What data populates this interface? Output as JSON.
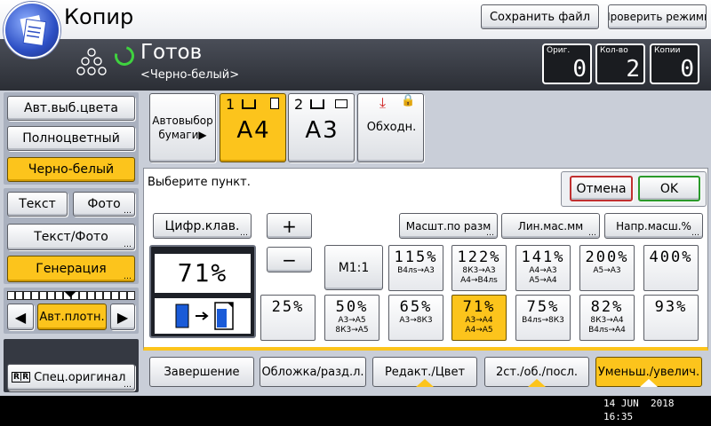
{
  "header": {
    "title": "Копир",
    "save_file": "Сохранить файл",
    "check_modes": "Проверить режимы"
  },
  "status": {
    "state": "Готов",
    "mode": "<Черно-белый>"
  },
  "counters": [
    {
      "label": "Ориг.",
      "value": "0"
    },
    {
      "label": "Кол-во",
      "value": "2"
    },
    {
      "label": "Копии",
      "value": "0"
    }
  ],
  "color_modes": [
    "Авт.выб.цвета",
    "Полноцветный",
    "Черно-белый"
  ],
  "original_types": {
    "text": "Текст",
    "photo": "Фото",
    "text_photo": "Текст/Фото",
    "generation": "Генерация"
  },
  "density": {
    "label": "Авт.плотн."
  },
  "special_original": "Спец.оригинал",
  "paper": {
    "auto": "Автовыбор бумаги▶",
    "tray1_num": "1",
    "tray1_size": "A4",
    "tray2_num": "2",
    "tray2_size": "A3",
    "bypass": "Обходн."
  },
  "panel": {
    "prompt": "Выберите пункт.",
    "cancel": "Отмена",
    "ok": "OK",
    "numpad": "Цифр.клав.",
    "fit_size": "Масшт.по разм",
    "lin_zoom": "Лин.мас.мм",
    "dir_zoom": "Напр.масш.%",
    "plus": "+",
    "minus": "−",
    "ratio_value": "71%",
    "m1": "M1:1"
  },
  "ratios": [
    {
      "big": "115%",
      "small": "B4лs→A3"
    },
    {
      "big": "122%",
      "small": "8К3→A3\nA4→B4лs"
    },
    {
      "big": "141%",
      "small": "A4→A3\nA5→A4"
    },
    {
      "big": "200%",
      "small": "A5→A3"
    },
    {
      "big": "400%",
      "small": ""
    },
    {
      "big": "25%",
      "small": ""
    },
    {
      "big": "50%",
      "small": "A3→A5\n8К3→A5"
    },
    {
      "big": "65%",
      "small": "A3→8К3"
    },
    {
      "big": "71%",
      "small": "A3→A4\nA4→A5"
    },
    {
      "big": "75%",
      "small": "B4лs→8К3"
    },
    {
      "big": "82%",
      "small": "8К3→A4\nB4лs→A4"
    },
    {
      "big": "93%",
      "small": ""
    }
  ],
  "tabs": [
    "Завершение",
    "Обложка/разд.л.",
    "Редакт./Цвет",
    "2ст./об./посл.",
    "Уменьш./увелич."
  ],
  "datetime": {
    "date": "14 JUN  2018",
    "time": "16:35"
  },
  "colors": {
    "accent": "#fcc41c",
    "status_bg": "#2f333b",
    "ready": "#3fd23f"
  }
}
